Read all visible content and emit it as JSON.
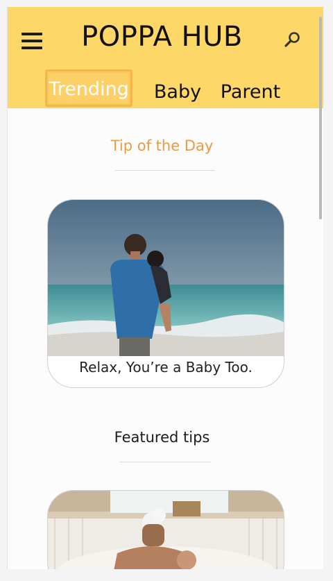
{
  "header": {
    "brand": "POPPA HUB",
    "menu_icon": "hamburger-menu-icon",
    "search_icon": "magnifier-search-icon",
    "background": "#fdd768"
  },
  "tabs": [
    {
      "label": "Trending",
      "active": true
    },
    {
      "label": "Baby",
      "active": false
    },
    {
      "label": "Parent",
      "active": false
    }
  ],
  "tip_of_day": {
    "title": "Tip of the Day",
    "title_color": "#e99a46",
    "card_caption": "Relax, You’re a Baby Too."
  },
  "featured": {
    "title": "Featured tips"
  }
}
